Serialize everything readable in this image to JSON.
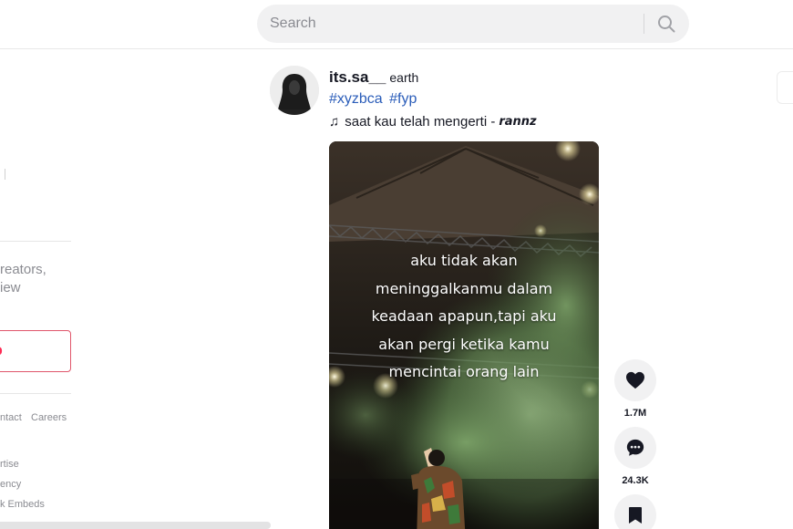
{
  "search": {
    "placeholder": "Search"
  },
  "sidebar": {
    "login_prompt": "reators,\niew",
    "login_button_label": "p",
    "footer_links": [
      "ntact",
      "Careers",
      "rtise",
      "ency",
      "k Embeds"
    ]
  },
  "post": {
    "username": "its.sa__",
    "nickname": "earth",
    "hashtags": [
      "#xyzbca",
      "#fyp"
    ],
    "music_title": "saat kau telah mengerti -",
    "music_artist": "rannz",
    "video_caption": "aku tidak akan\nmeninggalkanmu dalam\nkeadaan apapun,tapi aku\nakan pergi ketika kamu\nmencintai orang lain",
    "like_count": "1.7M",
    "comment_count": "24.3K"
  },
  "icons": {
    "search": "search-icon",
    "like": "heart-icon",
    "comment": "comment-icon",
    "save": "bookmark-icon",
    "music": "music-note-icon"
  },
  "colors": {
    "hashtag": "#2b5db9",
    "login_accent": "#fe2c55",
    "search_bg": "#f1f1f2"
  }
}
